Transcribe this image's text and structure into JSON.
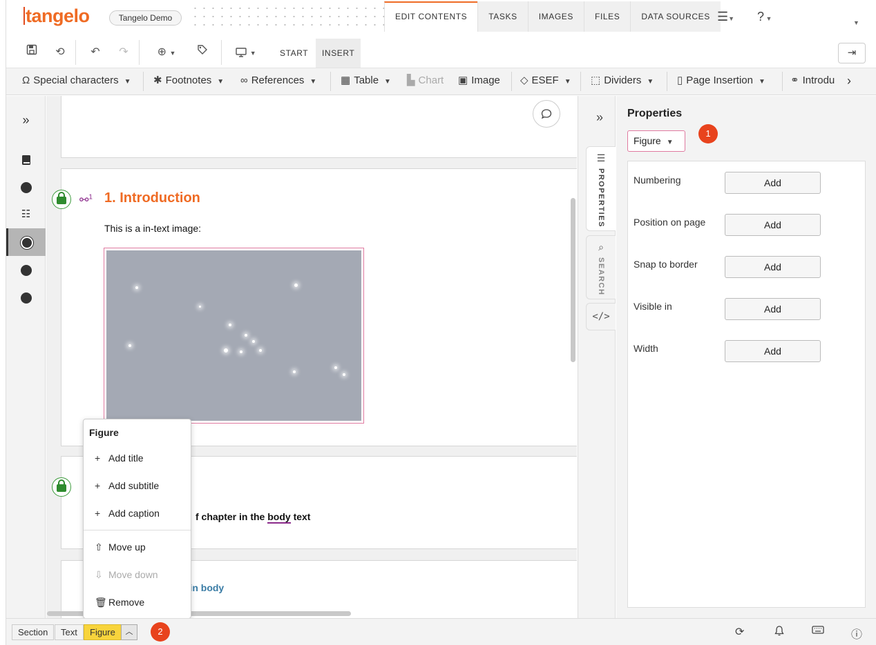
{
  "app": {
    "logo": "tangelo",
    "environment": "Tangelo Demo"
  },
  "tabs": [
    {
      "label": "EDIT CONTENTS",
      "active": true
    },
    {
      "label": "TASKS",
      "active": false
    },
    {
      "label": "IMAGES",
      "active": false
    },
    {
      "label": "FILES",
      "active": false
    },
    {
      "label": "DATA SOURCES",
      "active": false
    }
  ],
  "toolbar": {
    "start_label": "START",
    "insert_label": "INSERT"
  },
  "ribbon": {
    "special_characters": "Special characters",
    "footnotes": "Footnotes",
    "references": "References",
    "table": "Table",
    "chart": "Chart",
    "image": "Image",
    "esef": "ESEF",
    "dividers": "Dividers",
    "page_insertion": "Page Insertion",
    "introduction": "Introdu"
  },
  "document": {
    "heading": "1. Introduction",
    "link_badge": "1",
    "intro_text": "This is a in-text image:",
    "chapter_text_prefix": "f chapter in the ",
    "chapter_text_underlined": "body",
    "chapter_text_suffix": " text",
    "body_link_text": "h in body"
  },
  "context_menu": {
    "title": "Figure",
    "items": [
      {
        "label": "Add title",
        "icon": "plus-icon",
        "enabled": true
      },
      {
        "label": "Add subtitle",
        "icon": "plus-icon",
        "enabled": true
      },
      {
        "label": "Add caption",
        "icon": "plus-icon",
        "enabled": true
      },
      {
        "label": "Move up",
        "icon": "arrow-up-icon",
        "enabled": true
      },
      {
        "label": "Move down",
        "icon": "arrow-down-icon",
        "enabled": false
      },
      {
        "label": "Remove",
        "icon": "trash-icon",
        "enabled": true
      }
    ]
  },
  "side_tabs": {
    "properties": "PROPERTIES",
    "search": "SEARCH"
  },
  "properties": {
    "title": "Properties",
    "element_type": "Figure",
    "badge_1": "1",
    "rows": [
      {
        "label": "Numbering",
        "button": "Add"
      },
      {
        "label": "Position on page",
        "button": "Add"
      },
      {
        "label": "Snap to border",
        "button": "Add"
      },
      {
        "label": "Visible in",
        "button": "Add"
      },
      {
        "label": "Width",
        "button": "Add"
      }
    ]
  },
  "status_bar": {
    "breadcrumb": [
      "Section",
      "Text",
      "Figure"
    ],
    "badge_2": "2"
  },
  "colors": {
    "brand": "#ef6b24",
    "badge": "#e8431d",
    "active_crumb": "#f8d43c",
    "lock": "#2e8b2e"
  }
}
